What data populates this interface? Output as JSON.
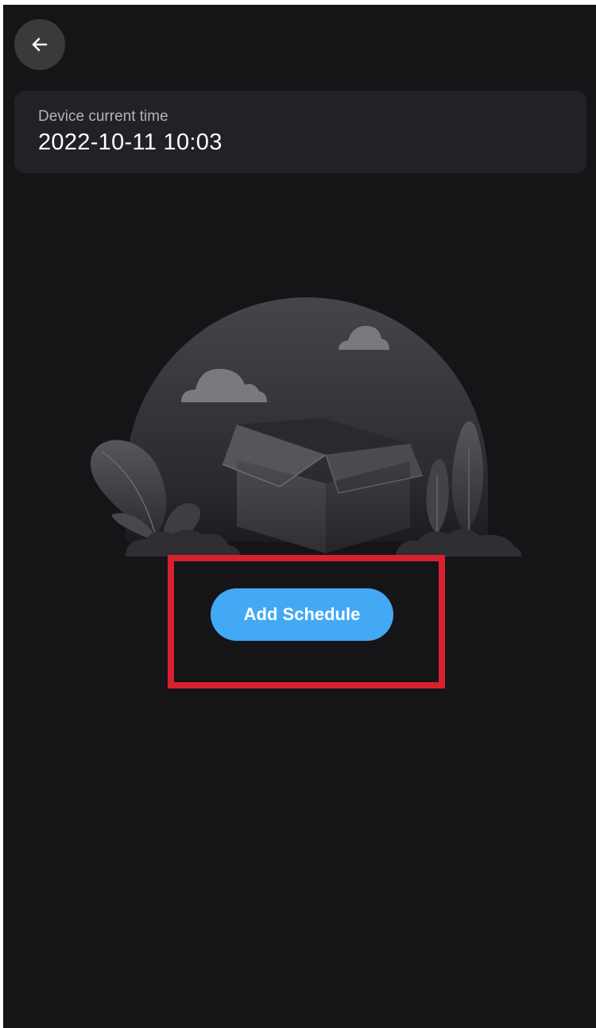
{
  "header": {
    "back_icon": "arrow-left-icon"
  },
  "time_card": {
    "label": "Device current time",
    "value": "2022-10-11 10:03"
  },
  "empty_state": {
    "illustration": "empty-box-illustration"
  },
  "actions": {
    "add_schedule_label": "Add Schedule"
  },
  "colors": {
    "background": "#151518",
    "card": "#222226",
    "accent": "#43a9f4",
    "highlight": "#d8212e"
  }
}
